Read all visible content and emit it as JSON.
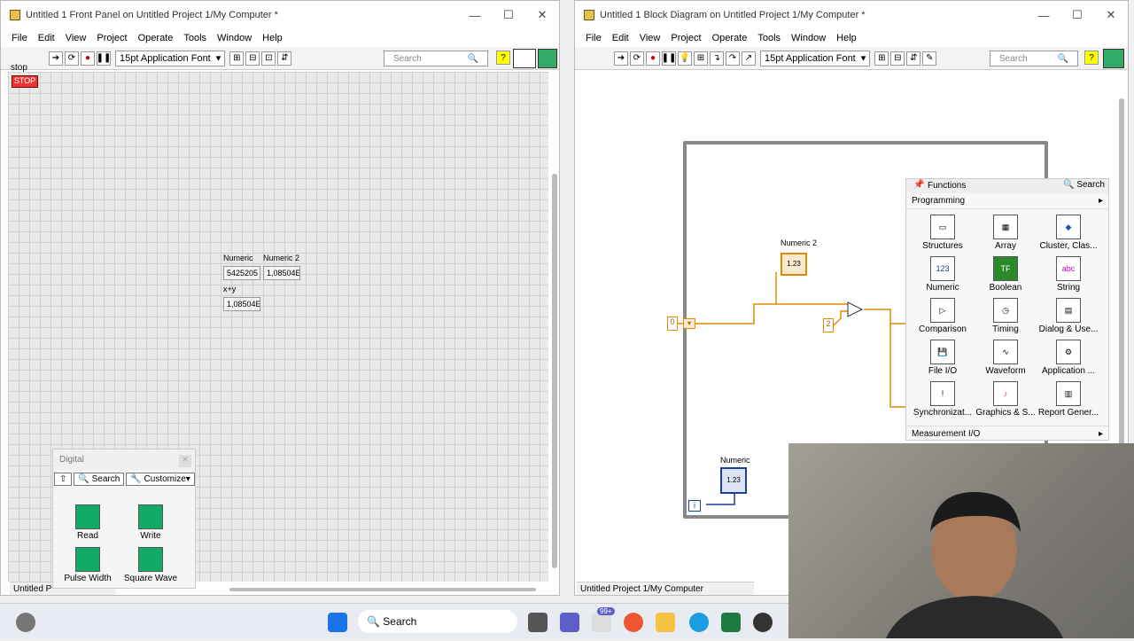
{
  "front": {
    "title": "Untitled 1 Front Panel on Untitled Project 1/My Computer *",
    "menu": [
      "File",
      "Edit",
      "View",
      "Project",
      "Operate",
      "Tools",
      "Window",
      "Help"
    ],
    "font": "15pt Application Font",
    "search": "Search",
    "stop_label": "stop",
    "stop_button": "STOP",
    "numeric_label": "Numeric",
    "numeric_value": "5425205",
    "numeric2_label": "Numeric 2",
    "numeric2_value": "1,08504E",
    "sum_label": "x+y",
    "sum_value": "1,08504E",
    "status": "Untitled P"
  },
  "digital": {
    "title": "Digital",
    "search": "Search",
    "customize": "Customize",
    "items": [
      "Read",
      "Write",
      "Pulse Width",
      "Square Wave"
    ]
  },
  "block": {
    "title": "Untitled 1 Block Diagram on Untitled Project 1/My Computer *",
    "menu": [
      "File",
      "Edit",
      "View",
      "Project",
      "Operate",
      "Tools",
      "Window",
      "Help"
    ],
    "font": "15pt Application Font",
    "search": "Search",
    "numeric2": "Numeric 2",
    "numeric": "Numeric",
    "const0": "0",
    "const2": "2",
    "iter": "i",
    "status": "Untitled Project 1/My Computer"
  },
  "functions": {
    "title": "Functions",
    "search": "Search",
    "category": "Programming",
    "items": [
      "Structures",
      "Array",
      "Cluster, Clas...",
      "Numeric",
      "Boolean",
      "String",
      "Comparison",
      "Timing",
      "Dialog & Use...",
      "File I/O",
      "Waveform",
      "Application ...",
      "Synchronizat...",
      "Graphics & S...",
      "Report Gener..."
    ],
    "bottom": "Measurement I/O"
  },
  "taskbar": {
    "search": "Search",
    "badge": "99+"
  }
}
